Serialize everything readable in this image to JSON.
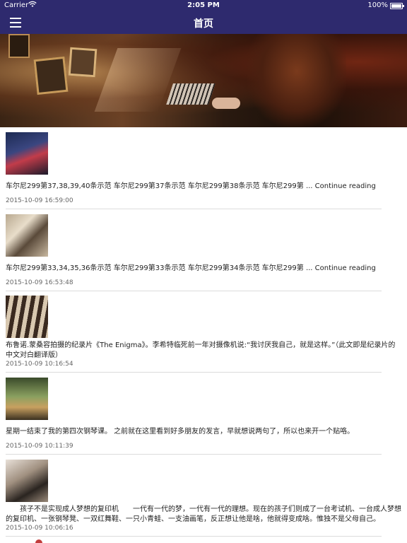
{
  "status_bar": {
    "carrier": "Carrier",
    "time": "2:05 PM",
    "battery": "100%"
  },
  "nav": {
    "title": "首页"
  },
  "posts": [
    {
      "excerpt": "车尔尼299第37,38,39,40条示范 车尔尼299第37条示范 车尔尼299第38条示范 车尔尼299第 ...",
      "more": "Continue reading",
      "date": "2015-10-09 16:59:00"
    },
    {
      "excerpt": "车尔尼299第33,34,35,36条示范 车尔尼299第33条示范 车尔尼299第34条示范 车尔尼299第 ...",
      "more": "Continue reading",
      "date": "2015-10-09 16:53:48"
    },
    {
      "excerpt": "布鲁诺.蒙桑容拍摄的纪录片《The Enigma》。李希特临死前一年对摄像机说:“我讨厌我自己，就是这样。”（此文即是纪录片的中文对白翻译版）",
      "more": "",
      "date": "2015-10-09 10:16:54"
    },
    {
      "excerpt": "星期一结束了我的第四次钢琴课。 之前就在这里看到好多朋友的发言，早就想说两句了，所以也来开一个贴咯。",
      "more": "",
      "date": "2015-10-09 10:11:39"
    },
    {
      "excerpt": "　　孩子不是实现成人梦想的复印机　　一代有一代的梦，一代有一代的理想。现在的孩子们则成了一台考试机、一台成人梦想的复印机、一张钢琴凳、一双红舞鞋、一只小青蛙、一支油画笔，反正想让他是啥，他就得变成啥。惟独不是父母自己。",
      "more": "",
      "date": "2015-10-09 10:06:16"
    }
  ]
}
